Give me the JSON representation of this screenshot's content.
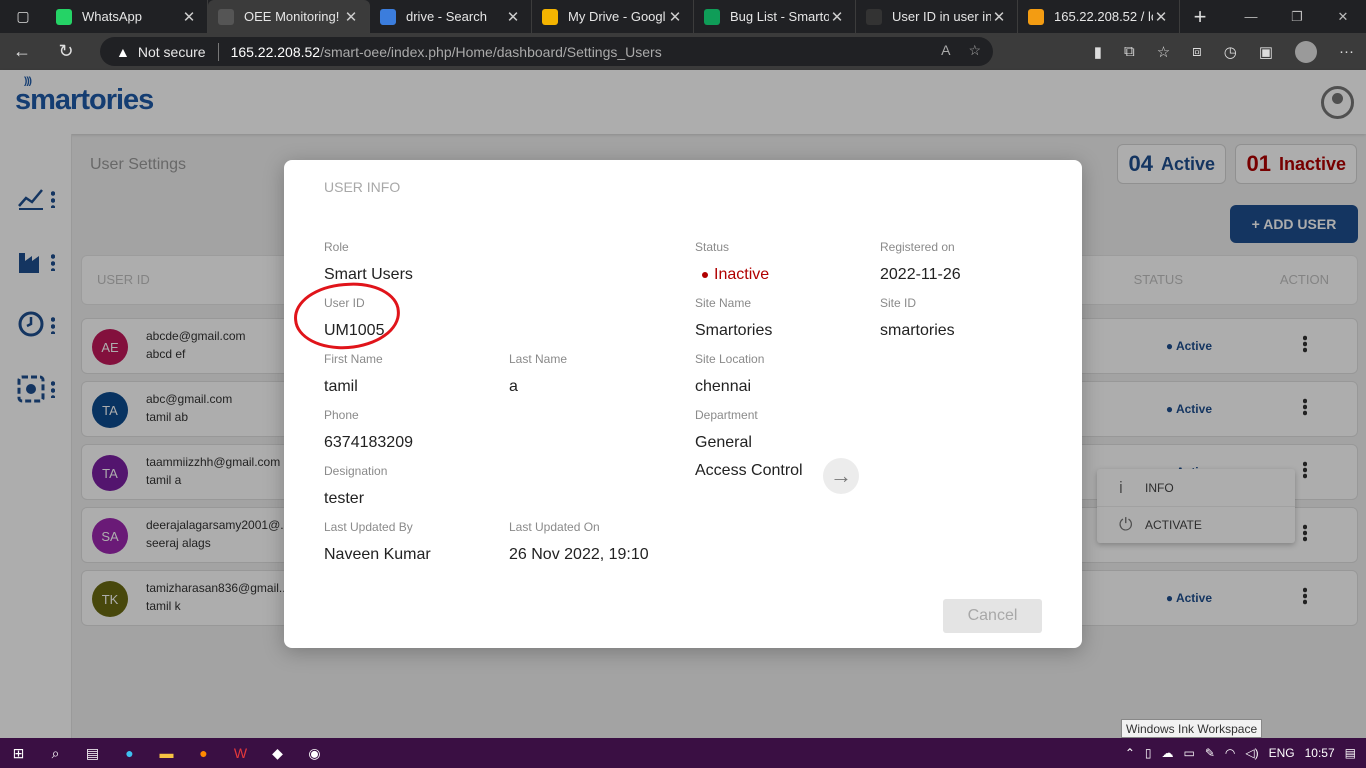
{
  "browser": {
    "tabs": [
      {
        "title": "WhatsApp",
        "favicon": "whatsapp-icon",
        "color": "#25d366"
      },
      {
        "title": "OEE Monitoring!",
        "favicon": "document-icon",
        "color": "#555555",
        "active": true
      },
      {
        "title": "drive - Search",
        "favicon": "search-icon",
        "color": "#3b7ddd"
      },
      {
        "title": "My Drive - Googl",
        "favicon": "google-drive-icon",
        "color": "#f4b400"
      },
      {
        "title": "Bug List - Smarto",
        "favicon": "google-sheets-icon",
        "color": "#0f9d58"
      },
      {
        "title": "User ID in user in",
        "favicon": "github-icon",
        "color": "#333333"
      },
      {
        "title": "165.22.208.52 / lc",
        "favicon": "phpmyadmin-icon",
        "color": "#f39c12"
      }
    ],
    "address": {
      "not_secure": "Not secure",
      "host": "165.22.208.52",
      "path": "/smart-oee/index.php/Home/dashboard/Settings_Users"
    }
  },
  "app": {
    "logo": "smartories",
    "page_title": "User Settings",
    "counts": {
      "active_num": "04",
      "active_label": "Active",
      "inactive_num": "01",
      "inactive_label": "Inactive"
    },
    "add_user_label": "+ ADD USER",
    "table": {
      "headers": {
        "user_id": "USER ID",
        "status": "STATUS",
        "action": "ACTION"
      },
      "rows": [
        {
          "initials": "AE",
          "color": "#c2185b",
          "email": "abcde@gmail.com",
          "name": "abcd ef",
          "status": "Active"
        },
        {
          "initials": "TA",
          "color": "#0d4c8f",
          "email": "abc@gmail.com",
          "name": "tamil ab",
          "status": "Active"
        },
        {
          "initials": "TA",
          "color": "#7b1fa2",
          "email": "taammiizzhh@gmail.com",
          "name": "tamil a",
          "status": "Active"
        },
        {
          "initials": "SA",
          "color": "#9c27b0",
          "email": "deerajalagarsamy2001@...",
          "name": "seeraj alags",
          "status": "Active"
        },
        {
          "initials": "TK",
          "color": "#6b6b12",
          "email": "tamizharasan836@gmail...",
          "name": "tamil k",
          "status": "Active"
        }
      ]
    },
    "row_menu": {
      "info": "INFO",
      "activate": "ACTIVATE"
    }
  },
  "modal": {
    "title": "USER INFO",
    "fields": {
      "role_label": "Role",
      "role": "Smart Users",
      "status_label": "Status",
      "status": "Inactive",
      "registered_label": "Registered on",
      "registered": "2022-11-26",
      "user_id_label": "User ID",
      "user_id": "UM1005",
      "site_name_label": "Site Name",
      "site_name": "Smartories",
      "site_id_label": "Site ID",
      "site_id": "smartories",
      "first_name_label": "First Name",
      "first_name": "tamil",
      "last_name_label": "Last Name",
      "last_name": "a",
      "site_location_label": "Site Location",
      "site_location": "chennai",
      "phone_label": "Phone",
      "phone": "6374183209",
      "department_label": "Department",
      "department": "General",
      "designation_label": "Designation",
      "designation": "tester",
      "access_control": "Access Control",
      "last_updated_by_label": "Last Updated By",
      "last_updated_by": "Naveen Kumar",
      "last_updated_on_label": "Last Updated On",
      "last_updated_on": "26 Nov 2022, 19:10"
    },
    "cancel_label": "Cancel"
  },
  "tooltip": "Windows Ink Workspace",
  "taskbar": {
    "lang": "ENG",
    "time": "10:57"
  }
}
